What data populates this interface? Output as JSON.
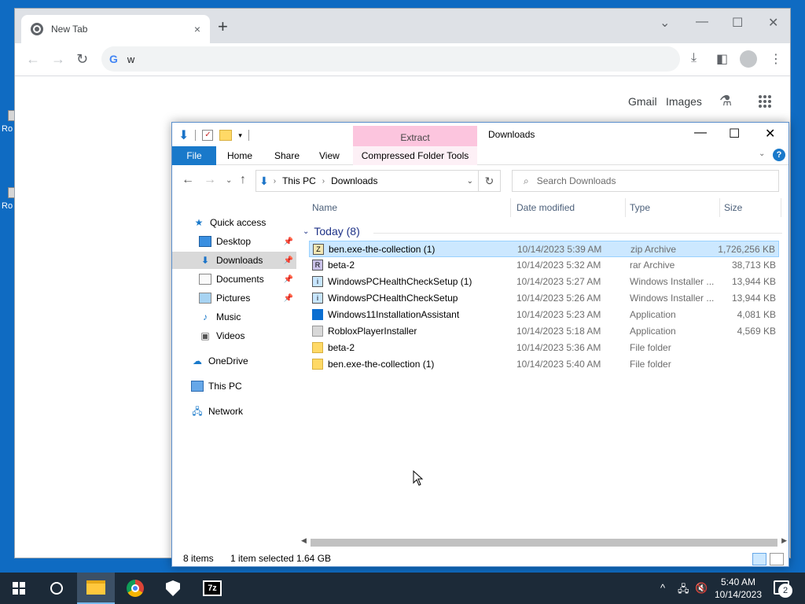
{
  "desktop": {
    "icons": [
      {
        "label": "Ro"
      },
      {
        "label": "Ro"
      }
    ]
  },
  "chrome": {
    "tab_title": "New Tab",
    "tab_close": "×",
    "new_tab": "+",
    "omnibox_value": "w",
    "omnibox_g": "G",
    "ntp_links": [
      "Gmail",
      "Images"
    ]
  },
  "explorer": {
    "window_title": "Downloads",
    "contextual_tab_top": "Extract",
    "ribbon_tabs": [
      "File",
      "Home",
      "Share",
      "View",
      "Compressed Folder Tools"
    ],
    "help": "?",
    "breadcrumb": [
      "This PC",
      "Downloads"
    ],
    "search_placeholder": "Search Downloads",
    "nav": {
      "quick_access": "Quick access",
      "items": [
        "Desktop",
        "Downloads",
        "Documents",
        "Pictures",
        "Music",
        "Videos"
      ],
      "onedrive": "OneDrive",
      "this_pc": "This PC",
      "network": "Network"
    },
    "columns": [
      "Name",
      "Date modified",
      "Type",
      "Size"
    ],
    "group_label": "Today (8)",
    "files": [
      {
        "name": "ben.exe-the-collection (1)",
        "date": "10/14/2023 5:39 AM",
        "type": "zip Archive",
        "size": "1,726,256 KB",
        "icon": "zip-archive-icon"
      },
      {
        "name": "beta-2",
        "date": "10/14/2023 5:32 AM",
        "type": "rar Archive",
        "size": "38,713 KB",
        "icon": "rar-archive-icon"
      },
      {
        "name": "WindowsPCHealthCheckSetup (1)",
        "date": "10/14/2023 5:27 AM",
        "type": "Windows Installer ...",
        "size": "13,944 KB",
        "icon": "installer-icon"
      },
      {
        "name": "WindowsPCHealthCheckSetup",
        "date": "10/14/2023 5:26 AM",
        "type": "Windows Installer ...",
        "size": "13,944 KB",
        "icon": "installer-icon"
      },
      {
        "name": "Windows11InstallationAssistant",
        "date": "10/14/2023 5:23 AM",
        "type": "Application",
        "size": "4,081 KB",
        "icon": "windows-logo-icon"
      },
      {
        "name": "RobloxPlayerInstaller",
        "date": "10/14/2023 5:18 AM",
        "type": "Application",
        "size": "4,569 KB",
        "icon": "roblox-icon"
      },
      {
        "name": "beta-2",
        "date": "10/14/2023 5:36 AM",
        "type": "File folder",
        "size": "",
        "icon": "folder-icon"
      },
      {
        "name": "ben.exe-the-collection (1)",
        "date": "10/14/2023 5:40 AM",
        "type": "File folder",
        "size": "",
        "icon": "folder-icon"
      }
    ],
    "status": {
      "items": "8 items",
      "selected": "1 item selected",
      "size": "1.64 GB"
    }
  },
  "taskbar": {
    "clock_time": "5:40 AM",
    "clock_date": "10/14/2023",
    "notification_count": "2",
    "sevenzip_label": "7z"
  }
}
